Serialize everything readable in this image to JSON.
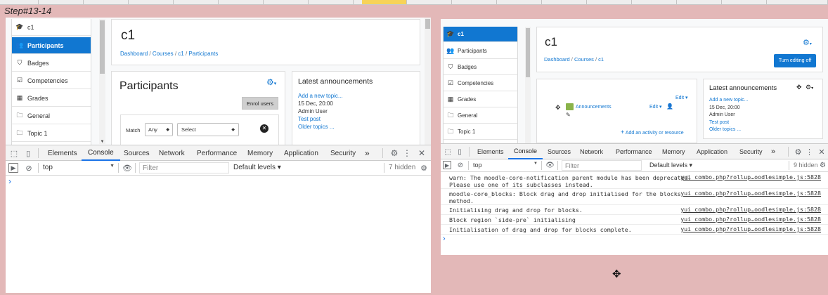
{
  "step_label": "Step#13-14",
  "left": {
    "sidebar": {
      "items": [
        {
          "icon": "graduation-cap-icon",
          "glyph": "🎓",
          "label": "c1",
          "active": false
        },
        {
          "icon": "users-icon",
          "glyph": "👥",
          "label": "Participants",
          "active": true
        },
        {
          "icon": "shield-icon",
          "glyph": "⛉",
          "label": "Badges",
          "active": false
        },
        {
          "icon": "checkbox-icon",
          "glyph": "☑",
          "label": "Competencies",
          "active": false
        },
        {
          "icon": "table-icon",
          "glyph": "▦",
          "label": "Grades",
          "active": false
        },
        {
          "icon": "folder-icon",
          "glyph": "🗀",
          "label": "General",
          "active": false
        },
        {
          "icon": "folder-icon",
          "glyph": "🗀",
          "label": "Topic 1",
          "active": false
        }
      ]
    },
    "header": {
      "title": "c1",
      "breadcrumb": [
        "Dashboard",
        "Courses",
        "c1",
        "Participants"
      ]
    },
    "participants": {
      "heading": "Participants",
      "enrol_label": "Enrol users",
      "match_label": "Match",
      "match_value": "Any",
      "select_value": "Select"
    },
    "announcements": {
      "title": "Latest announcements",
      "add_link": "Add a new topic...",
      "date": "15 Dec, 20:00",
      "author": "Admin User",
      "post": "Test post",
      "older": "Older topics ..."
    },
    "devtools": {
      "tabs": [
        "Elements",
        "Console",
        "Sources",
        "Network",
        "Performance",
        "Memory",
        "Application",
        "Security"
      ],
      "active_tab": "Console",
      "more": "»",
      "context": "top",
      "filter_placeholder": "Filter",
      "levels": "Default levels ▾",
      "hidden": "7 hidden",
      "prompt": "›"
    }
  },
  "right": {
    "sidebar": {
      "items": [
        {
          "icon": "graduation-cap-icon",
          "glyph": "🎓",
          "label": "c1",
          "active": true
        },
        {
          "icon": "users-icon",
          "glyph": "👥",
          "label": "Participants",
          "active": false
        },
        {
          "icon": "shield-icon",
          "glyph": "⛉",
          "label": "Badges",
          "active": false
        },
        {
          "icon": "checkbox-icon",
          "glyph": "☑",
          "label": "Competencies",
          "active": false
        },
        {
          "icon": "table-icon",
          "glyph": "▦",
          "label": "Grades",
          "active": false
        },
        {
          "icon": "folder-icon",
          "glyph": "🗀",
          "label": "General",
          "active": false
        },
        {
          "icon": "folder-icon",
          "glyph": "🗀",
          "label": "Topic 1",
          "active": false
        }
      ]
    },
    "header": {
      "title": "c1",
      "breadcrumb": [
        "Dashboard",
        "Courses",
        "c1"
      ],
      "editing_button": "Turn editing off"
    },
    "section": {
      "edit_label": "Edit ▾",
      "activity": "Announcements",
      "activity_edit": "Edit ▾",
      "add_activity": "Add an activity or resource"
    },
    "announcements": {
      "title": "Latest announcements",
      "add_link": "Add a new topic...",
      "date": "15 Dec, 20:00",
      "author": "Admin User",
      "post": "Test post",
      "older": "Older topics ..."
    },
    "devtools": {
      "tabs": [
        "Elements",
        "Console",
        "Sources",
        "Network",
        "Performance",
        "Memory",
        "Application",
        "Security"
      ],
      "active_tab": "Console",
      "more": "»",
      "context": "top",
      "filter_placeholder": "Filter",
      "levels": "Default levels ▾",
      "hidden": "9 hidden",
      "prompt": "›",
      "logs": [
        {
          "message": "warn: The moodle-core-notification parent module has been deprecated.\nPlease use one of its subclasses instead.",
          "source": "yui_combo.php?rollup…oodlesimple.js:5828"
        },
        {
          "message": "moodle-core_blocks: Block drag and drop initialised for the blocks\nmethod.",
          "source": "yui_combo.php?rollup…oodlesimple.js:5828"
        },
        {
          "message": "Initialising drag and drop for blocks.",
          "source": "yui_combo.php?rollup…oodlesimple.js:5828"
        },
        {
          "message": "Block region `side-pre` initialising",
          "source": "yui_combo.php?rollup…oodlesimple.js:5828"
        },
        {
          "message": "Initialisation of drag and drop for blocks complete.",
          "source": "yui_combo.php?rollup…oodlesimple.js:5828"
        }
      ]
    }
  },
  "colors": {
    "background": "#e3b8b8",
    "accent": "#1177d1",
    "devtools_active": "#1a73e8"
  }
}
